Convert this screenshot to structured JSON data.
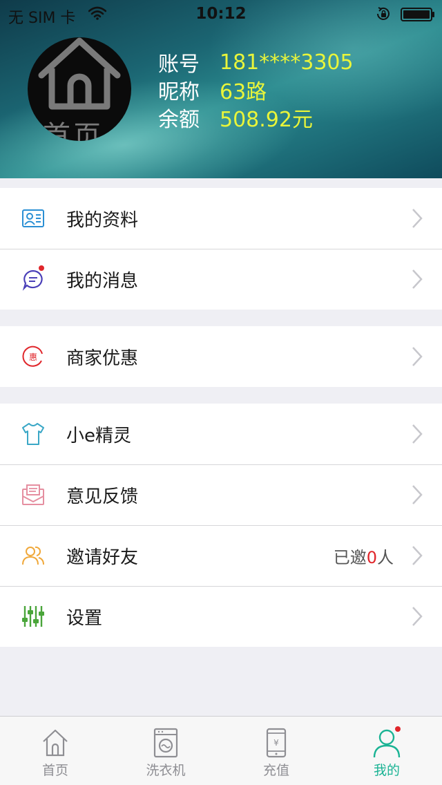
{
  "status_bar": {
    "carrier": "无 SIM 卡",
    "time": "10:12"
  },
  "profile": {
    "avatar_text": "首页",
    "account_label": "账号",
    "account_value": "181****3305",
    "nickname_label": "昵称",
    "nickname_value": "63路",
    "balance_label": "余额",
    "balance_value": "508.92元"
  },
  "menu": {
    "group1": [
      {
        "label": "我的资料",
        "icon": "profile-card-icon"
      },
      {
        "label": "我的消息",
        "icon": "message-bubble-icon"
      }
    ],
    "group2": [
      {
        "label": "商家优惠",
        "icon": "discount-icon"
      }
    ],
    "group3": [
      {
        "label": "小e精灵",
        "icon": "tshirt-icon"
      },
      {
        "label": "意见反馈",
        "icon": "envelope-icon"
      },
      {
        "label": "邀请好友",
        "icon": "users-icon",
        "extra_prefix": "已邀",
        "extra_count": "0",
        "extra_suffix": "人"
      },
      {
        "label": "设置",
        "icon": "sliders-icon"
      }
    ]
  },
  "tabs": [
    {
      "label": "首页",
      "icon": "home-icon"
    },
    {
      "label": "洗衣机",
      "icon": "washing-machine-icon"
    },
    {
      "label": "充值",
      "icon": "phone-recharge-icon"
    },
    {
      "label": "我的",
      "icon": "user-icon",
      "active": true
    }
  ],
  "colors": {
    "accent": "#1ab394",
    "highlight_text": "#e9f53a",
    "badge": "#e0262b"
  }
}
